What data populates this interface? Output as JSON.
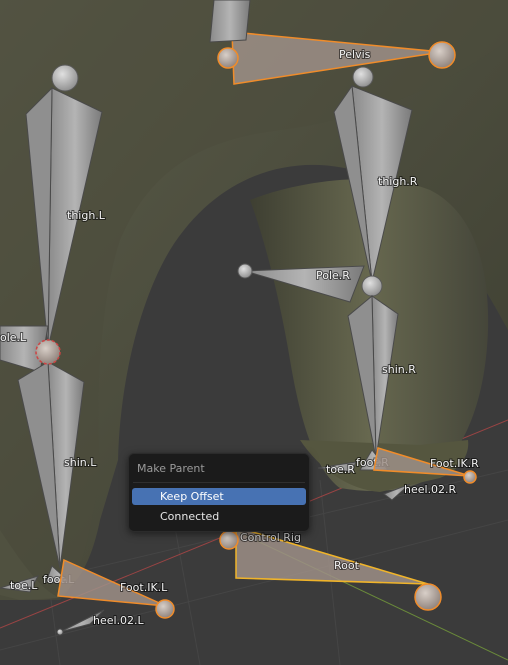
{
  "viewport": {
    "bones": {
      "pelvis": "Pelvis",
      "thigh_l": "thigh.L",
      "thigh_r": "thigh.R",
      "pole_r": "Pole.R",
      "pole_l": "ole.L",
      "shin_r": "shin.R",
      "shin_l": "shin.L",
      "toe_r": "toe.R",
      "foot_r": "foot.R",
      "foot_ik_r": "Foot.IK.R",
      "heel_02_r": "heel.02.R",
      "control_rig": "Control Rig",
      "root": "Root",
      "toe_l": "toe.L",
      "foot_l": "foot.L",
      "foot_ik_l": "Foot.IK.L",
      "heel_02_l": "heel.02.L"
    }
  },
  "context_menu": {
    "title": "Make Parent",
    "items": [
      {
        "label": "Keep Offset",
        "active": true
      },
      {
        "label": "Connected",
        "active": false
      }
    ]
  },
  "colors": {
    "selection_outline": "#f08c2a",
    "active_highlight": "#4772b3",
    "menu_bg": "#1b1b1b"
  }
}
